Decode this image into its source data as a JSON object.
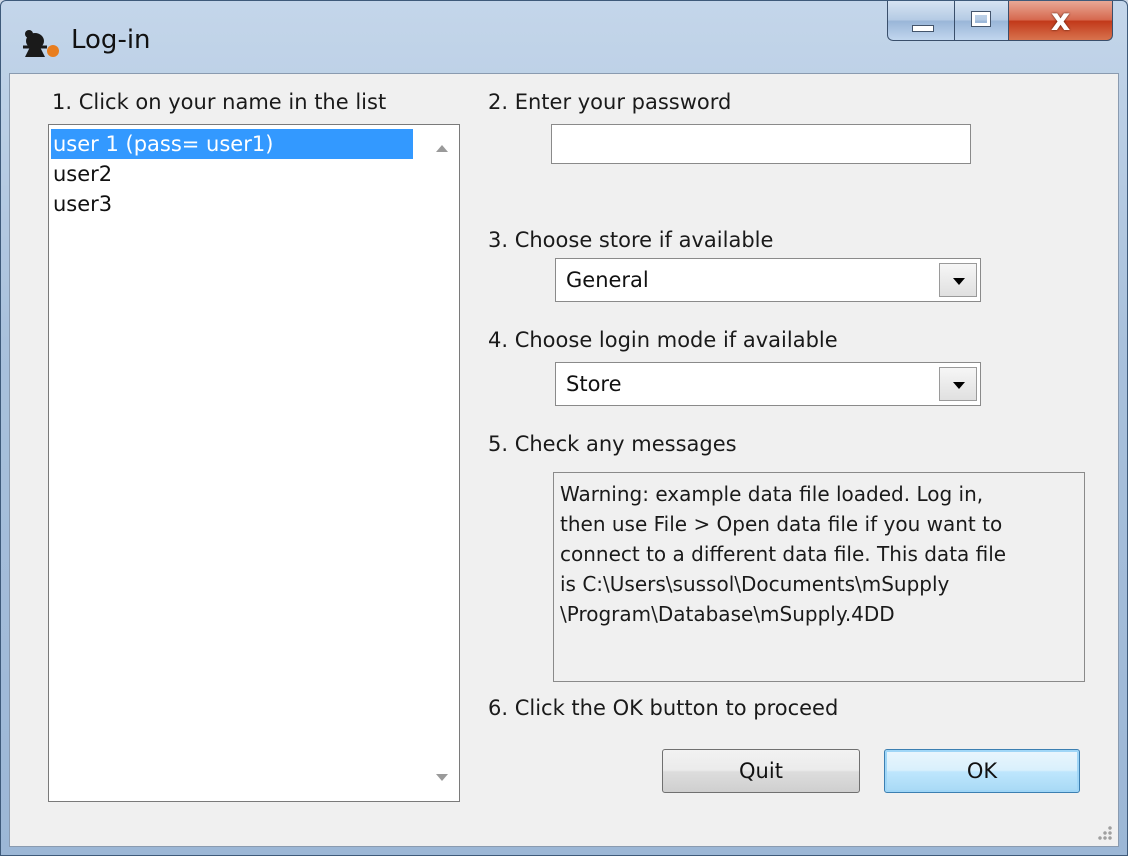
{
  "window": {
    "title": "Log-in",
    "app_icon": "msupply-app-icon",
    "controls": {
      "minimize": "minimize-icon",
      "maximize": "maximize-icon",
      "close_glyph": "x"
    }
  },
  "steps": {
    "step1": "1. Click on your name in the list",
    "step2": "2. Enter your password",
    "step3": "3. Choose store if available",
    "step4": "4. Choose login mode if available",
    "step5": "5. Check any messages",
    "step6": "6. Click the OK button to proceed"
  },
  "users": {
    "items": [
      {
        "label": "user 1 (pass= user1)",
        "selected": true
      },
      {
        "label": "user2",
        "selected": false
      },
      {
        "label": "user3",
        "selected": false
      }
    ]
  },
  "password": {
    "value": "",
    "placeholder": ""
  },
  "store_select": {
    "value": "General"
  },
  "login_mode_select": {
    "value": "Store"
  },
  "messages": {
    "text": "Warning: example data file loaded. Log in,\nthen use File > Open data file if you want to\nconnect to a different data file. This data file\nis C:\\Users\\sussol\\Documents\\mSupply\n\\Program\\Database\\mSupply.4DD"
  },
  "buttons": {
    "quit": "Quit",
    "ok": "OK"
  },
  "colors": {
    "selection": "#3399ff",
    "title_bar": "#a9c1dc",
    "close_button": "#c2391a",
    "dialog_background": "#f0f0f0"
  }
}
